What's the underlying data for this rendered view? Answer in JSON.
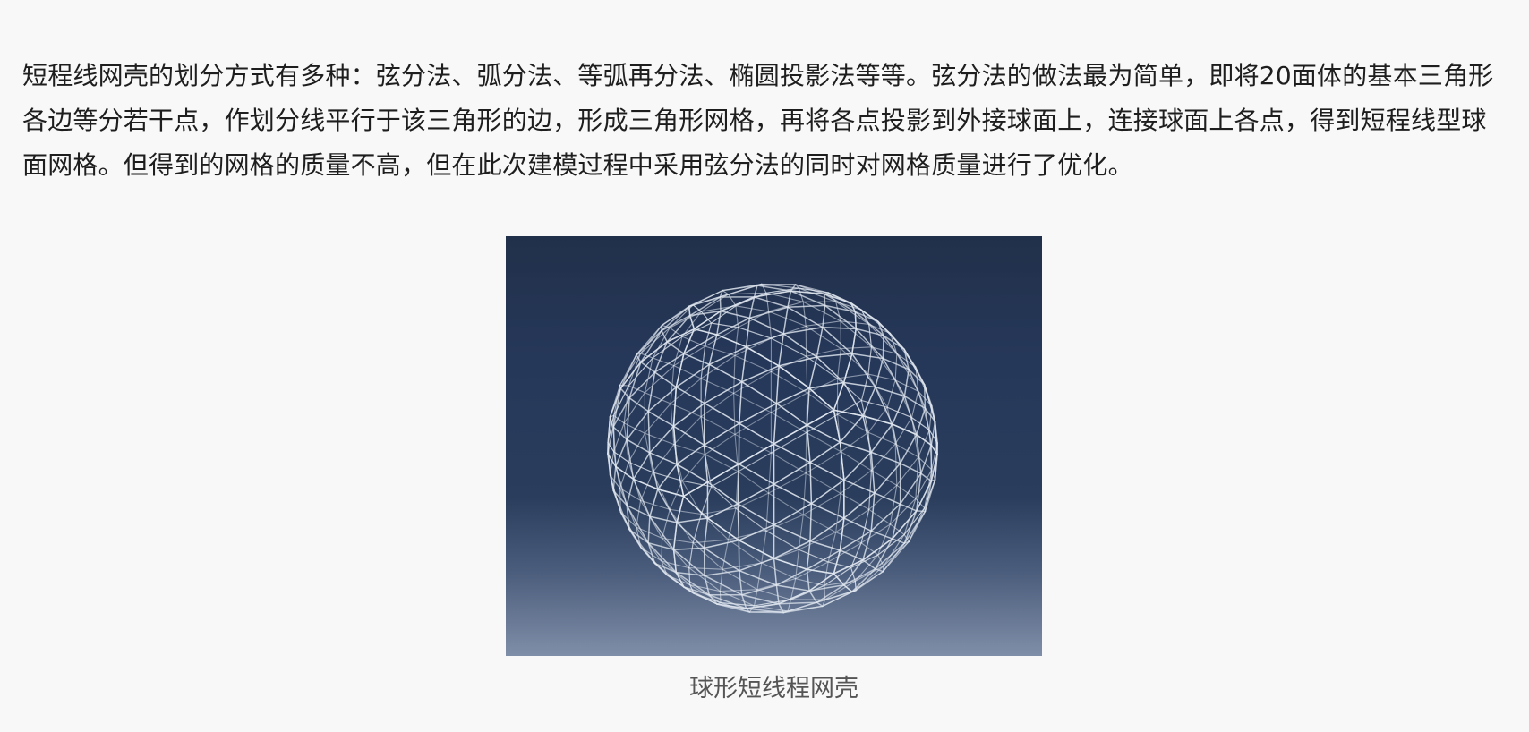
{
  "article": {
    "paragraph": "短程线网壳的划分方式有多种：弦分法、弧分法、等弧再分法、椭圆投影法等等。弦分法的做法最为简单，即将20面体的基本三角形各边等分若干点，作划分线平行于该三角形的边，形成三角形网格，再将各点投影到外接球面上，连接球面上各点，得到短程线型球面网格。但得到的网格的质量不高，但在此次建模过程中采用弦分法的同时对网格质量进行了优化。",
    "figure_caption": "球形短线程网壳"
  },
  "figure": {
    "type": "geodesic-sphere-wireframe",
    "line_color": "#dfe6ef"
  }
}
